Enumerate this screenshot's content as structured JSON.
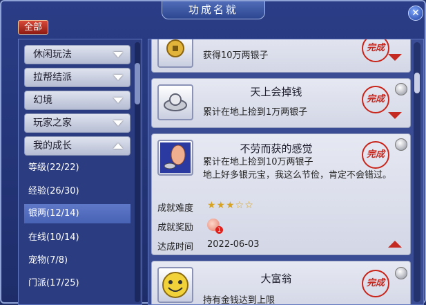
{
  "window": {
    "title": "功成名就",
    "close_symbol": "✕"
  },
  "filter": {
    "all_label": "全部"
  },
  "categories": [
    {
      "label": "休闲玩法",
      "expanded": false
    },
    {
      "label": "拉帮结派",
      "expanded": false
    },
    {
      "label": "幻境",
      "expanded": false
    },
    {
      "label": "玩家之家",
      "expanded": false
    },
    {
      "label": "我的成长",
      "expanded": true
    }
  ],
  "subcategories": [
    {
      "label": "等级(22/22)",
      "selected": false
    },
    {
      "label": "经验(26/30)",
      "selected": false
    },
    {
      "label": "银两(12/14)",
      "selected": true
    },
    {
      "label": "在线(10/14)",
      "selected": false
    },
    {
      "label": "宠物(7/8)",
      "selected": false
    },
    {
      "label": "门派(17/25)",
      "selected": false
    }
  ],
  "achievements": [
    {
      "title": "",
      "desc": "获得10万两银子",
      "icon": "coin-icon",
      "seal": "完成"
    },
    {
      "title": "天上会掉钱",
      "desc": "累计在地上捡到1万两银子",
      "icon": "silver-ingot-icon",
      "seal": "完成"
    },
    {
      "title": "不劳而获的感觉",
      "desc": "累计在地上捡到10万两银子",
      "flavor": "地上好多银元宝，我这么节俭，肯定不会错过。",
      "icon": "foot-ingot-icon",
      "seal": "完成",
      "difficulty_label": "成就难度",
      "difficulty_stars": "★★★☆☆",
      "reward_label": "成就奖励",
      "reward_count": "1",
      "time_label": "达成时间",
      "time_value": "2022-06-03"
    },
    {
      "title": "大富翁",
      "desc": "持有金钱达到上限",
      "icon": "smiley-coin-icon",
      "seal": "完成"
    }
  ],
  "colors": {
    "accent_red": "#c42a22",
    "selected_bg": "#5470c2",
    "star": "#d7a320"
  }
}
